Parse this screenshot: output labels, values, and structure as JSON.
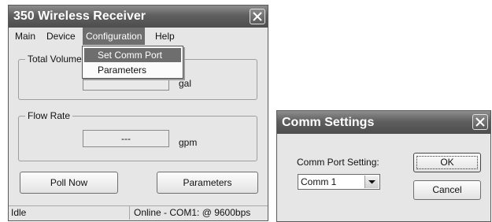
{
  "main_window": {
    "title": "350 Wireless Receiver",
    "menu": {
      "main": "Main",
      "device": "Device",
      "configuration": "Configuration",
      "help": "Help"
    },
    "configuration_menu_items": [
      "Set Comm Port",
      "Parameters"
    ],
    "total_volume": {
      "label": "Total Volume",
      "value": "",
      "unit": "gal"
    },
    "flow_rate": {
      "label": "Flow Rate",
      "value": "---",
      "unit": "gpm"
    },
    "buttons": {
      "poll_now": "Poll Now",
      "parameters": "Parameters"
    },
    "status": {
      "state": "Idle",
      "connection": "Online - COM1: @ 9600bps"
    }
  },
  "comm_dialog": {
    "title": "Comm Settings",
    "port_label": "Comm Port Setting:",
    "port_selected": "Comm 1",
    "ok": "OK",
    "cancel": "Cancel"
  },
  "icons": [
    "close-icon",
    "chevron-down-icon"
  ],
  "colors": {
    "titlebar": "#5f5f5f",
    "window_bg": "#e6e6e6",
    "menu_highlight": "#6e6e6e"
  }
}
